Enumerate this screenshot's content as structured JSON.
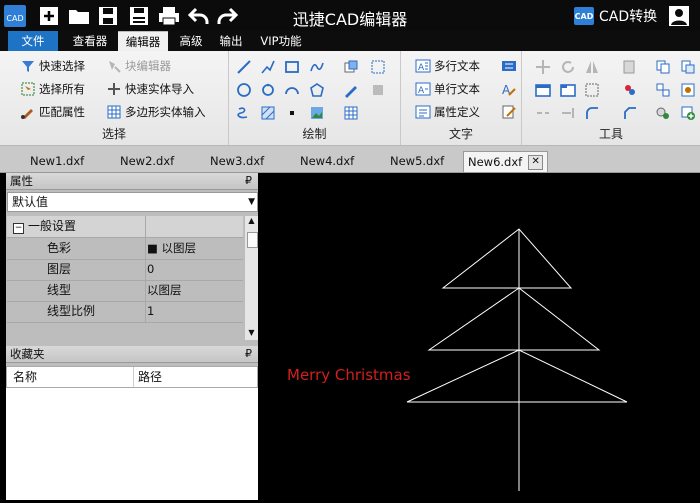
{
  "app": {
    "title": "迅捷CAD编辑器",
    "logo_text": "CAD",
    "cad_convert_label": "CAD转换",
    "quick_access": [
      "new-file-icon",
      "open-folder-icon",
      "save-icon",
      "save-as-icon",
      "print-icon",
      "undo-icon",
      "redo-icon"
    ]
  },
  "menu": {
    "tabs": [
      "文件",
      "查看器",
      "编辑器",
      "高级",
      "输出",
      "VIP功能"
    ],
    "active": "编辑器"
  },
  "ribbon": {
    "select": {
      "label": "选择",
      "buttons": [
        "快速选择",
        "块编辑器",
        "选择所有",
        "快速实体导入",
        "匹配属性",
        "多边形实体输入"
      ]
    },
    "draw": {
      "label": "绘制"
    },
    "text": {
      "label": "文字",
      "buttons": [
        "多行文本",
        "单行文本",
        "属性定义"
      ]
    },
    "tools": {
      "label": "工具"
    }
  },
  "doc_tabs": {
    "items": [
      "New1.dxf",
      "New2.dxf",
      "New3.dxf",
      "New4.dxf",
      "New5.dxf",
      "New6.dxf"
    ],
    "active": "New6.dxf",
    "close_symbol": "✕"
  },
  "properties": {
    "header": "属性",
    "pin_symbol": "₽",
    "selector_value": "默认值",
    "category": "一般设置",
    "rows": [
      {
        "name": "色彩",
        "value": "■ 以图层"
      },
      {
        "name": "图层",
        "value": "0"
      },
      {
        "name": "线型",
        "value": "以图层"
      },
      {
        "name": "线型比例",
        "value": "1"
      }
    ]
  },
  "favorites": {
    "header": "收藏夹",
    "columns": [
      "名称",
      "路径"
    ]
  },
  "canvas": {
    "text": "Merry Christmas",
    "text_color": "#d21f1f",
    "line_color": "#ffffff",
    "background": "#000000"
  },
  "colors": {
    "accent": "#1f73c4",
    "titlebar": "#0b0b0b"
  }
}
